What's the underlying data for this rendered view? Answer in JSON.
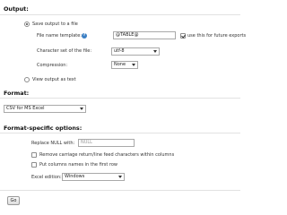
{
  "output": {
    "title": "Output:",
    "save_to_file_label": "Save output to a file",
    "file_name_template_label": "File name template:",
    "file_name_template_value": "@TABLE@",
    "use_for_future_label": "use this for future exports",
    "charset_label": "Character set of the file:",
    "charset_value": "utf-8",
    "compression_label": "Compression:",
    "compression_value": "None",
    "view_as_text_label": "View output as text"
  },
  "format": {
    "title": "Format:",
    "selected": "CSV for MS Excel"
  },
  "format_options": {
    "title": "Format-specific options:",
    "replace_null_label": "Replace NULL with:",
    "replace_null_placeholder": "NULL",
    "remove_crlf_label": "Remove carriage return/line feed characters within columns",
    "column_names_label": "Put columns names in the first row",
    "excel_edition_label": "Excel edition:",
    "excel_edition_value": "Windows"
  },
  "go_label": "Go",
  "icons": {
    "help": "help-icon"
  },
  "colors": {
    "help_icon": "#3b7fc4"
  }
}
